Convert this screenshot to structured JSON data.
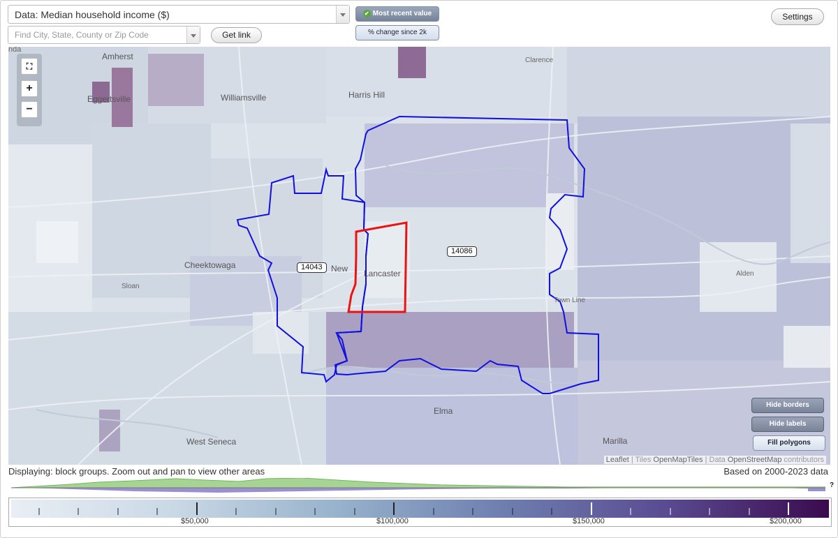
{
  "controls": {
    "data_select": "Data: Median household income ($)",
    "search_placeholder": "Find City, State, County or Zip Code",
    "get_link": "Get link",
    "most_recent": "Most recent value",
    "pct_change": "% change since 2k",
    "settings": "Settings"
  },
  "map": {
    "place_labels": {
      "nda": "nda",
      "amherst": "Amherst",
      "eggertsville": "Eggertsville",
      "williamsville": "Williamsville",
      "harris_hill": "Harris Hill",
      "clarence": "Clarence",
      "cheektowaga": "Cheektowaga",
      "sloan": "Sloan",
      "new": "New",
      "lancaster": "Lancaster",
      "alden": "Alden",
      "town_line": "Town Line",
      "elma": "Elma",
      "marilla": "Marilla",
      "west_seneca": "West Seneca"
    },
    "zip_labels": {
      "zip_14043": "14043",
      "zip_14086": "14086"
    },
    "zoom_in": "+",
    "zoom_out": "−",
    "hide_borders": "Hide borders",
    "hide_labels": "Hide labels",
    "fill_polygons": "Fill polygons",
    "attribution": {
      "leaflet": "Leaflet",
      "sep1": " | Tiles ",
      "tiles": "OpenMapTiles",
      "sep2": " | Data ",
      "data": "OpenStreetMap",
      "tail": " contributors"
    }
  },
  "footer": {
    "displaying": "Displaying: block groups. Zoom out and pan to view other areas",
    "based_on": "Based on 2000-2023 data",
    "help": "?"
  },
  "legend": {
    "ticks": [
      "$50,000",
      "$100,000",
      "$150,000",
      "$200,000"
    ]
  }
}
